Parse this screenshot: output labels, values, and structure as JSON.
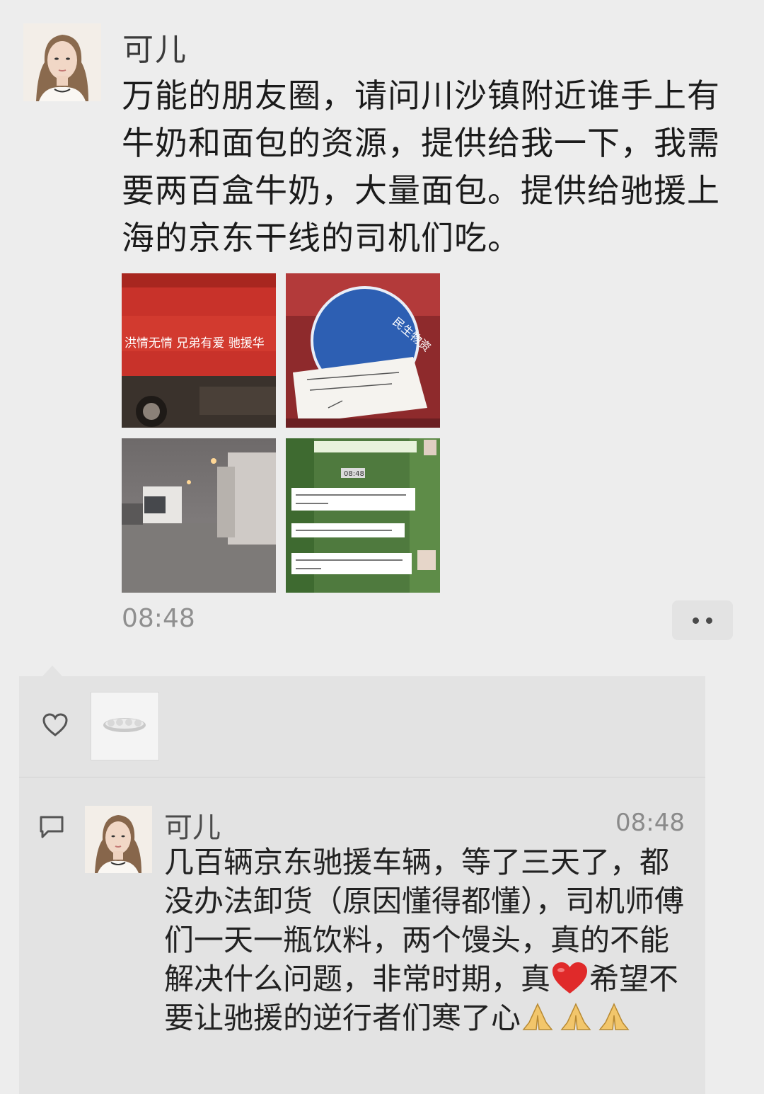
{
  "post": {
    "author": "可儿",
    "content": "万能的朋友圈，请问川沙镇附近谁手上有牛奶和面包的资源，提供给我一下，我需要两百盒牛奶，大量面包。提供给驰援上海的京东干线的司机们吃。",
    "time": "08:48",
    "photos": [
      {
        "icon": "truck-banner-photo",
        "caption": "洪情无情  兄弟有爱  驰援华"
      },
      {
        "icon": "food-box-label-photo",
        "caption": "民生物资"
      },
      {
        "icon": "trucks-at-night-photo"
      },
      {
        "icon": "chat-screenshot-photo",
        "caption": "08:48"
      }
    ]
  },
  "likes": {
    "icon": "heart-outline-icon",
    "count": 1
  },
  "comment": {
    "author": "可儿",
    "time": "08:48",
    "text_before_heart": "几百辆京东驰援车辆，等了三天了，都没办法卸货（原因懂得都懂），司机师傅们一天一瓶饮料，两个馒头，真的不能解决什么问题，非常时期，真",
    "text_after_heart": "希望不要让驰援的逆行者们寒了心",
    "emojis": [
      "red-heart-emoji",
      "folded-hands-emoji"
    ]
  },
  "colors": {
    "background": "#ededed",
    "interaction_panel": "#e3e3e3",
    "heart": "#e02a2a"
  }
}
